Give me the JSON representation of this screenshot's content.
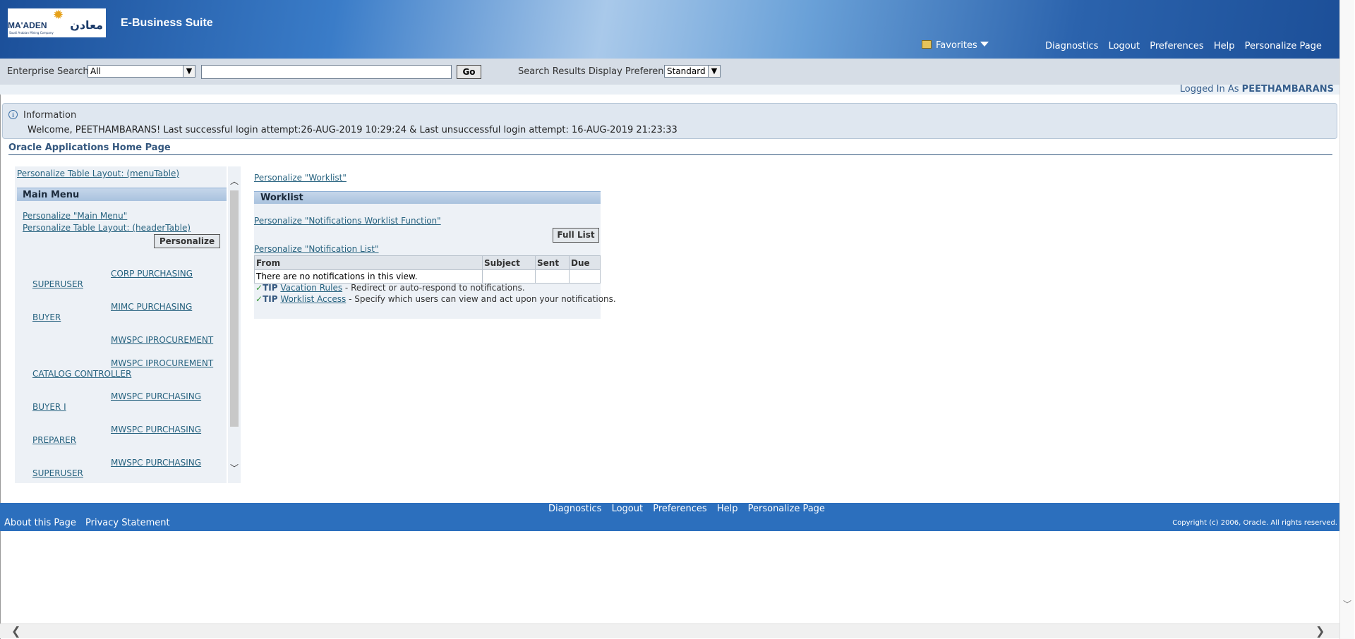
{
  "header": {
    "logo_text": "MA'ADEN",
    "logo_arabic": "معادن",
    "logo_tagline": "Saudi Arabian Mining Company",
    "suite_title": "E-Business Suite",
    "favorites_label": "Favorites",
    "global_nav": [
      "Diagnostics",
      "Logout",
      "Preferences",
      "Help",
      "Personalize Page"
    ]
  },
  "search": {
    "label": "Enterprise Search",
    "scope_value": "All",
    "query_value": "",
    "go_label": "Go",
    "display_pref_label": "Search Results Display Preference",
    "display_pref_value": "Standard"
  },
  "session": {
    "logged_in_prefix": "Logged In As",
    "user": "PEETHAMBARANS"
  },
  "info": {
    "title": "Information",
    "message": "Welcome, PEETHAMBARANS! Last successful login attempt:26-AUG-2019 10:29:24 & Last unsuccessful login attempt: 16-AUG-2019 21:23:33"
  },
  "page_title": "Oracle Applications Home Page",
  "left_panel": {
    "personalize_table_layout_menu": "Personalize Table Layout: (menuTable)",
    "main_menu_header": "Main Menu",
    "personalize_main_menu": "Personalize \"Main Menu\"",
    "personalize_header_table": "Personalize Table Layout: (headerTable)",
    "personalize_button": "Personalize",
    "responsibilities": [
      {
        "line1": "CORP PURCHASING",
        "line2": "SUPERUSER"
      },
      {
        "line1": "MIMC PURCHASING",
        "line2": "BUYER"
      },
      {
        "line1": "MWSPC IPROCUREMENT",
        "line2": ""
      },
      {
        "line1": "MWSPC IPROCUREMENT",
        "line2": "CATALOG CONTROLLER"
      },
      {
        "line1": "MWSPC PURCHASING",
        "line2": "BUYER I"
      },
      {
        "line1": "MWSPC PURCHASING",
        "line2": "PREPARER"
      },
      {
        "line1": "MWSPC PURCHASING",
        "line2": "SUPERUSER"
      }
    ]
  },
  "worklist": {
    "personalize_worklist": "Personalize \"Worklist\"",
    "header": "Worklist",
    "personalize_function": "Personalize \"Notifications Worklist Function\"",
    "full_list_button": "Full List",
    "personalize_notification_list": "Personalize \"Notification List\"",
    "columns": [
      "From",
      "Subject",
      "Sent",
      "Due"
    ],
    "empty_message": "There are no notifications in this view.",
    "tips": [
      {
        "label": "TIP",
        "link": "Vacation Rules",
        "text": " - Redirect or auto-respond to notifications."
      },
      {
        "label": "TIP",
        "link": "Worklist Access",
        "text": " - Specify which users can view and act upon your notifications."
      }
    ]
  },
  "footer": {
    "nav": [
      "Diagnostics",
      "Logout",
      "Preferences",
      "Help",
      "Personalize Page"
    ],
    "about": "About this Page",
    "privacy": "Privacy Statement",
    "copyright": "Copyright (c) 2006, Oracle. All rights reserved."
  },
  "icons": {
    "info": "info-icon",
    "favorites": "favorites-star-icon",
    "tip_check": "checkmark-icon",
    "scroll_up": "chevron-up-icon",
    "scroll_down": "chevron-down-icon"
  },
  "colors": {
    "header_blue": "#1b4f99",
    "footer_blue": "#2c6fbd",
    "link": "#26627f",
    "title": "#34577e"
  }
}
